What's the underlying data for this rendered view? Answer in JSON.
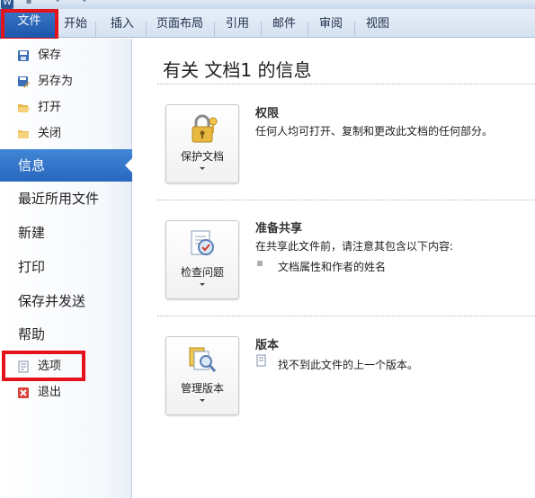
{
  "quick_access": {
    "app_badge": "W"
  },
  "ribbon": {
    "file_tab": "文件",
    "tabs": [
      "开始",
      "插入",
      "页面布局",
      "引用",
      "邮件",
      "审阅",
      "视图"
    ]
  },
  "sidebar": {
    "small_items": [
      {
        "label": "保存",
        "icon": "save-icon"
      },
      {
        "label": "另存为",
        "icon": "save-as-icon"
      },
      {
        "label": "打开",
        "icon": "open-folder-icon"
      },
      {
        "label": "关闭",
        "icon": "close-folder-icon"
      }
    ],
    "big_items": [
      "信息",
      "最近所用文件",
      "新建",
      "打印",
      "保存并发送",
      "帮助"
    ],
    "active_item": "信息",
    "bottom_items": [
      {
        "label": "选项",
        "icon": "options-icon"
      },
      {
        "label": "退出",
        "icon": "exit-icon"
      }
    ]
  },
  "main": {
    "title": "有关 文档1 的信息",
    "sections": [
      {
        "button_label": "保护文档",
        "icon": "lock-keys-icon",
        "heading": "权限",
        "description": "任何人均可打开、复制和更改此文档的任何部分。"
      },
      {
        "button_label": "检查问题",
        "icon": "inspect-document-icon",
        "heading": "准备共享",
        "description": "在共享此文件前，请注意其包含以下内容:",
        "bullet": "文档属性和作者的姓名"
      },
      {
        "button_label": "管理版本",
        "icon": "manage-versions-icon",
        "heading": "版本",
        "description": "找不到此文件的上一个版本。"
      }
    ]
  },
  "highlight_color": "#e4121b",
  "accent_color": "#2867bf"
}
